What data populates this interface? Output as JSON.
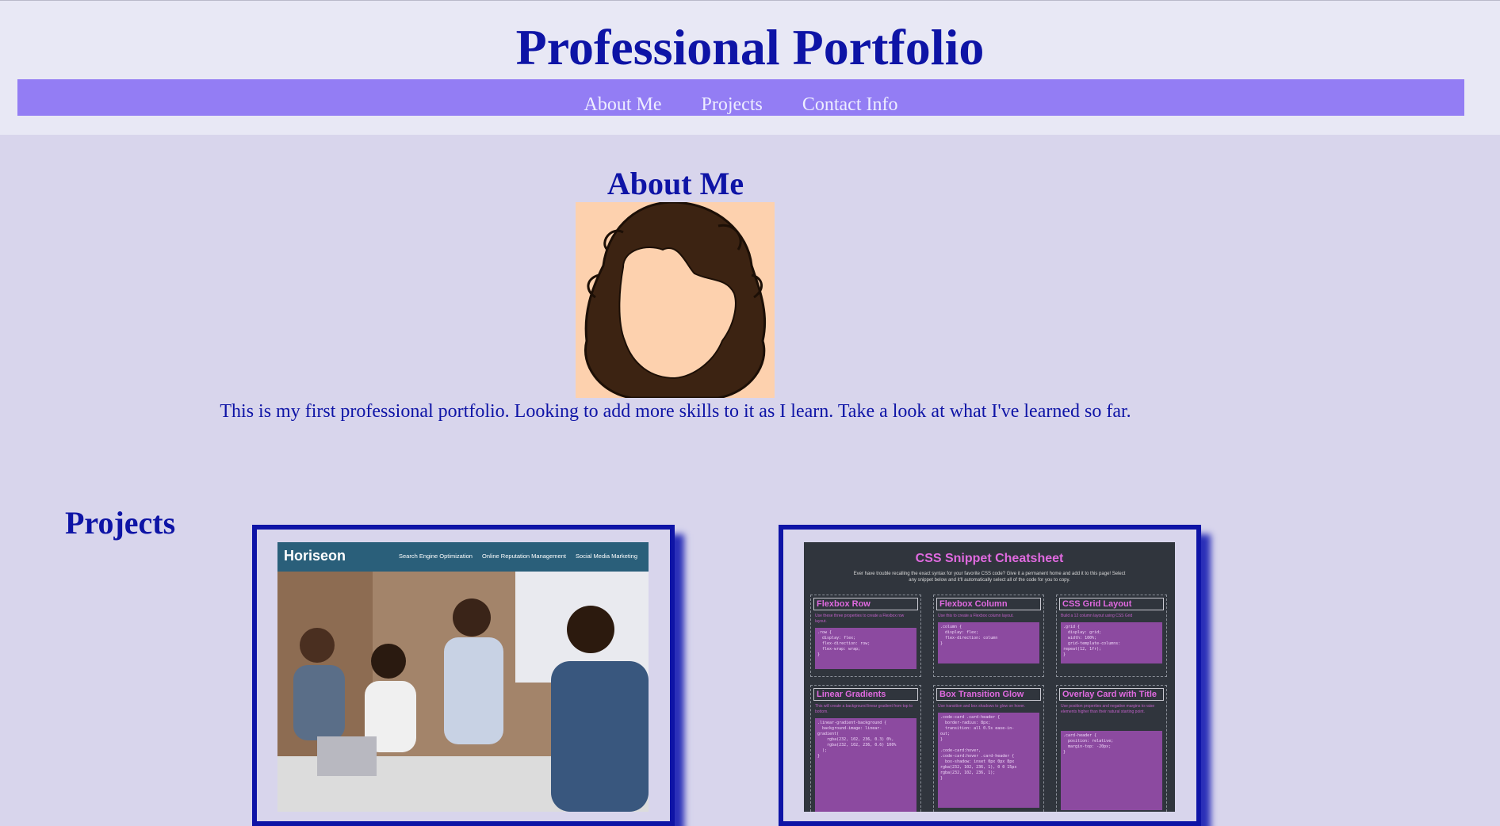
{
  "header": {
    "title": "Professional Portfolio",
    "nav": [
      "About Me",
      "Projects",
      "Contact Info"
    ]
  },
  "about": {
    "heading": "About Me",
    "text": "This is my first professional portfolio. Looking to add more skills to it as I learn. Take a look at what I've learned so far."
  },
  "projects": {
    "heading": "Projects",
    "horiseon": {
      "logo": "Horiseon",
      "links": [
        "Search Engine Optimization",
        "Online Reputation Management",
        "Social Media Marketing"
      ]
    },
    "cheatsheet": {
      "title": "CSS Snippet Cheatsheet",
      "subtitle": "Ever have trouble recalling the exact syntax for your favorite CSS code? Give it a permanent home and add it to this page! Select any snippet below and it'll automatically select all of the code for you to copy.",
      "panels": [
        {
          "title": "Flexbox Row",
          "desc": "Use these three properties to create a Flexbox row layout.",
          "code": ".row {\n  display: flex;\n  flex-direction: row;\n  flex-wrap: wrap;\n}"
        },
        {
          "title": "Flexbox Column",
          "desc": "Use this to create a Flexbox column layout.",
          "code": ".column {\n  display: flex;\n  flex-direction: column\n}"
        },
        {
          "title": "CSS Grid Layout",
          "desc": "Build a 12 column layout using CSS Grid",
          "code": ".grid {\n  display: grid;\n  width: 100%;\n  grid-template-columns:\nrepeat(12, 1fr);\n}"
        },
        {
          "title": "Linear Gradients",
          "desc": "This will create a background linear gradient from top to bottom.",
          "code": ".linear-gradient-background {\n  background-image: linear-\ngradient(\n    rgba(232, 102, 236, 0.3) 0%,\n    rgba(232, 102, 236, 0.6) 100%\n  );\n}"
        },
        {
          "title": "Box Transition Glow",
          "desc": "Use transition and box shadows to glow on hover.",
          "code": ".code-card .card-header {\n  border-radius: 8px;\n  transition: all 0.5s ease-in-\nout;\n}\n\n.code-card:hover,\n.code-card:hover .card-header {\n  box-shadow: inset 0px 0px 8px\nrgba(232, 102, 236, 1), 0 0 15px\nrgba(232, 102, 236, 1);\n}"
        },
        {
          "title": "Overlay Card with Title",
          "desc": "Use position properties and negative margins to raise elements higher than their natural starting point.",
          "code": ".card-header {\n  position: relative;\n  margin-top: -20px;\n}"
        }
      ]
    }
  }
}
